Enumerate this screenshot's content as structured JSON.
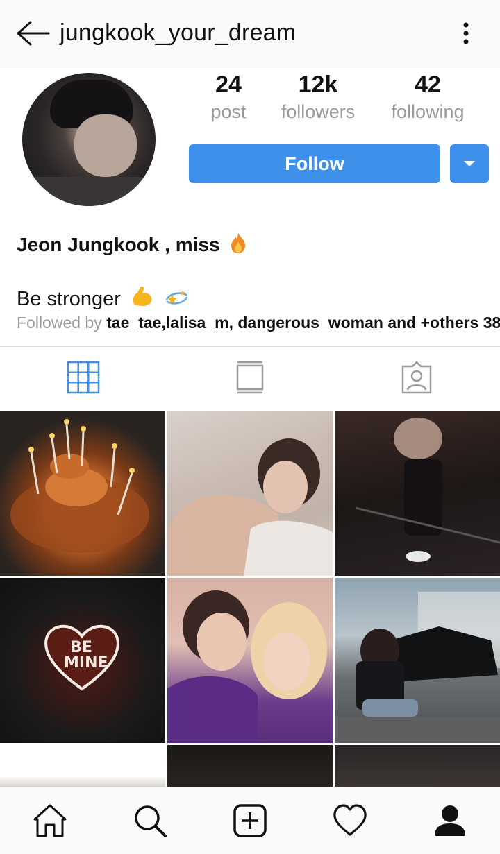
{
  "header": {
    "username": "jungkook_your_dream",
    "back_icon": "arrow-left-icon",
    "menu_icon": "more-vertical-icon"
  },
  "profile": {
    "stats": [
      {
        "value": "24",
        "label": "post"
      },
      {
        "value": "12k",
        "label": "followers"
      },
      {
        "value": "42",
        "label": "following"
      }
    ],
    "follow_label": "Follow",
    "display_name": "Jeon Jungkook , miss",
    "bio": "Be stronger",
    "followed_prefix": "Followed by",
    "followed_names": "tae_tae,lalisa_m, dangerous_woman and +others 38",
    "accent_color": "#3e90ea"
  },
  "tabs": [
    {
      "icon": "grid-icon",
      "active": true
    },
    {
      "icon": "feed-icon",
      "active": false
    },
    {
      "icon": "tagged-icon",
      "active": false
    }
  ],
  "grid_tile_2": {
    "heart_text_line1": "BE",
    "heart_text_line2": "MINE"
  },
  "bottom_nav": [
    {
      "icon": "home-icon"
    },
    {
      "icon": "search-icon"
    },
    {
      "icon": "add-post-icon"
    },
    {
      "icon": "activity-heart-icon"
    },
    {
      "icon": "profile-icon"
    }
  ]
}
